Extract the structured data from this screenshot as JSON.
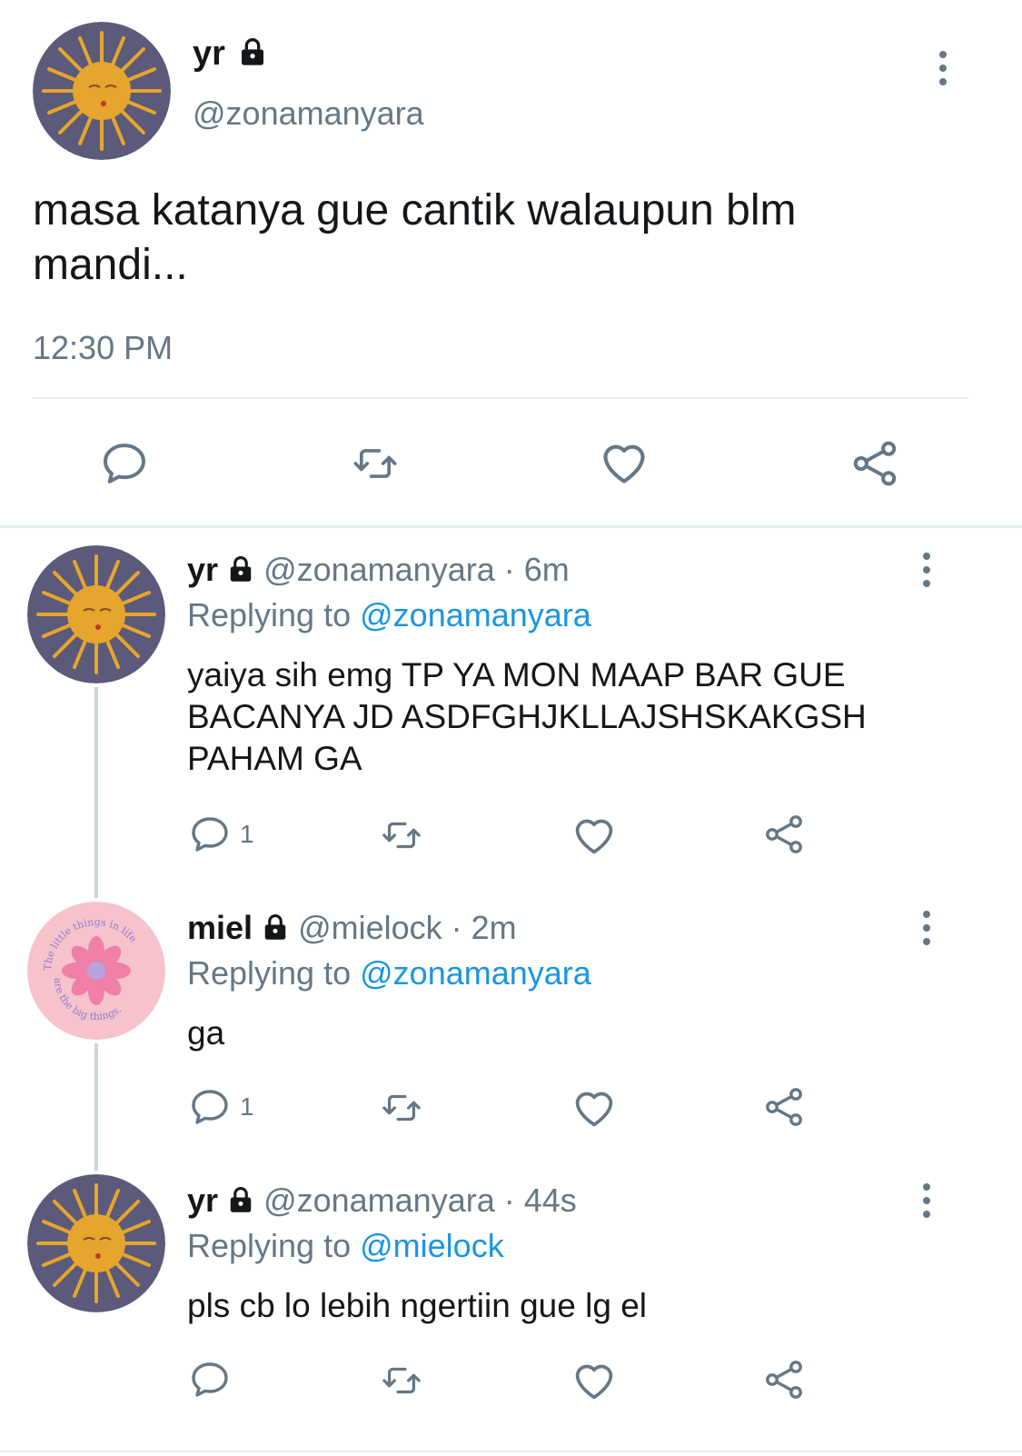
{
  "main_tweet": {
    "display_name": "yr",
    "handle": "@zonamanyara",
    "text_line1": "masa katanya gue cantik walaupun blm",
    "text_line2": "mandi...",
    "time": "12:30 PM"
  },
  "replies": [
    {
      "display_name": "yr",
      "handle": "@zonamanyara",
      "age": "· 6m",
      "replying_prefix": "Replying to",
      "replying_to": "@zonamanyara",
      "lines": [
        "yaiya sih emg TP YA MON MAAP BAR GUE",
        "BACANYA JD ASDFGHJKLLAJSHSKAKGSH",
        "PAHAM GA"
      ],
      "reply_count": "1"
    },
    {
      "display_name": "miel",
      "handle": "@mielock",
      "age": "· 2m",
      "replying_prefix": "Replying to",
      "replying_to": "@zonamanyara",
      "lines": [
        "ga"
      ],
      "reply_count": "1",
      "avatar_text_top": "The little things in life",
      "avatar_text_bottom": "are the big things."
    },
    {
      "display_name": "yr",
      "handle": "@zonamanyara",
      "age": "· 44s",
      "replying_prefix": "Replying to",
      "replying_to": "@mielock",
      "lines": [
        "pls cb lo lebih ngertiin gue lg el"
      ],
      "reply_count": ""
    }
  ],
  "icons": {
    "lock": "lock-icon",
    "reply": "reply-icon",
    "retweet": "retweet-icon",
    "like": "heart-icon",
    "share": "share-icon",
    "more": "more-icon"
  },
  "colors": {
    "text": "#14171a",
    "secondary": "#657786",
    "link": "#1b95e0",
    "divider": "#e6ecf0",
    "sun_bg": "#5b5a7a",
    "sun": "#e6a52c",
    "miel_bg": "#f6c3cc",
    "flower": "#f07fa8"
  }
}
